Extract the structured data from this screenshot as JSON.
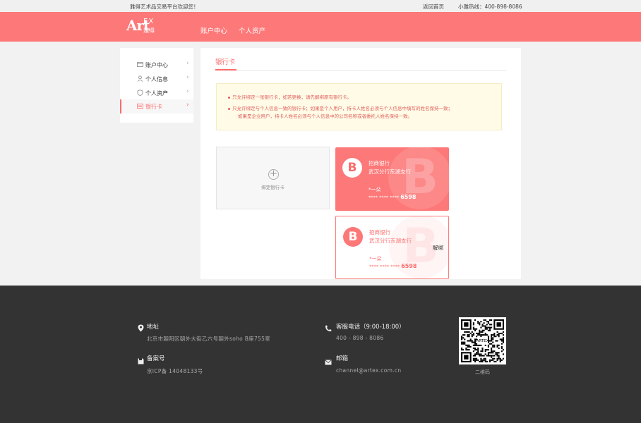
{
  "topbar": {
    "welcome": "雅得艺术品交易平台欢迎您！",
    "home_link": "返回首页",
    "hotline": "小雅热线：400-898-8086"
  },
  "header": {
    "logo_art": "Art",
    "logo_ex": "EX",
    "logo_cn": "雅得",
    "nav": [
      "账户中心",
      "个人资产"
    ],
    "brand_color": "#fd7878"
  },
  "sidebar": {
    "items": [
      {
        "label": "账户中心",
        "icon": "wallet-icon"
      },
      {
        "label": "个人信息",
        "icon": "user-icon"
      },
      {
        "label": "个人资产",
        "icon": "shield-icon"
      },
      {
        "label": "银行卡",
        "icon": "card-icon",
        "active": true
      }
    ]
  },
  "main": {
    "title": "银行卡",
    "notice": [
      "只允许绑定一张银行卡，如若更换，请先解绑原有银行卡。",
      "只允许绑定与个人信息一致的银行卡；如果是个人用户，持卡人姓名必须与个人信息中填写的姓名保持一致；",
      "如果是企业用户，持卡人姓名必须与个人信息中的公司名称或者委托人姓名保持一致。"
    ],
    "add_card_label": "绑定银行卡",
    "add_card_icon": "plus-icon",
    "cards": [
      {
        "bank": "招商银行",
        "branch": "武汉分行东湖支行",
        "holder": "*一朵",
        "mask": "****  **** ****",
        "tail": "6598",
        "unbind": ""
      },
      {
        "bank": "招商银行",
        "branch": "武汉分行东湖支行",
        "holder": "*一朵",
        "mask": "****  **** ****",
        "tail": "6598",
        "unbind": "解绑"
      }
    ],
    "bank_logo_letter": "B"
  },
  "footer": {
    "address_title": "地址",
    "address": "北京市朝阳区朝外大街乙六号朝外soho B座755室",
    "icp_title": "备案号",
    "icp": "京ICP备 14048133号",
    "phone_title": "客服电话（9:00-18:00）",
    "phone": "400 - 898 - 8086",
    "email_title": "邮箱",
    "email": "channel@artex.com.cn",
    "qr_label": "二维码",
    "qr_center": "ARTEX"
  }
}
